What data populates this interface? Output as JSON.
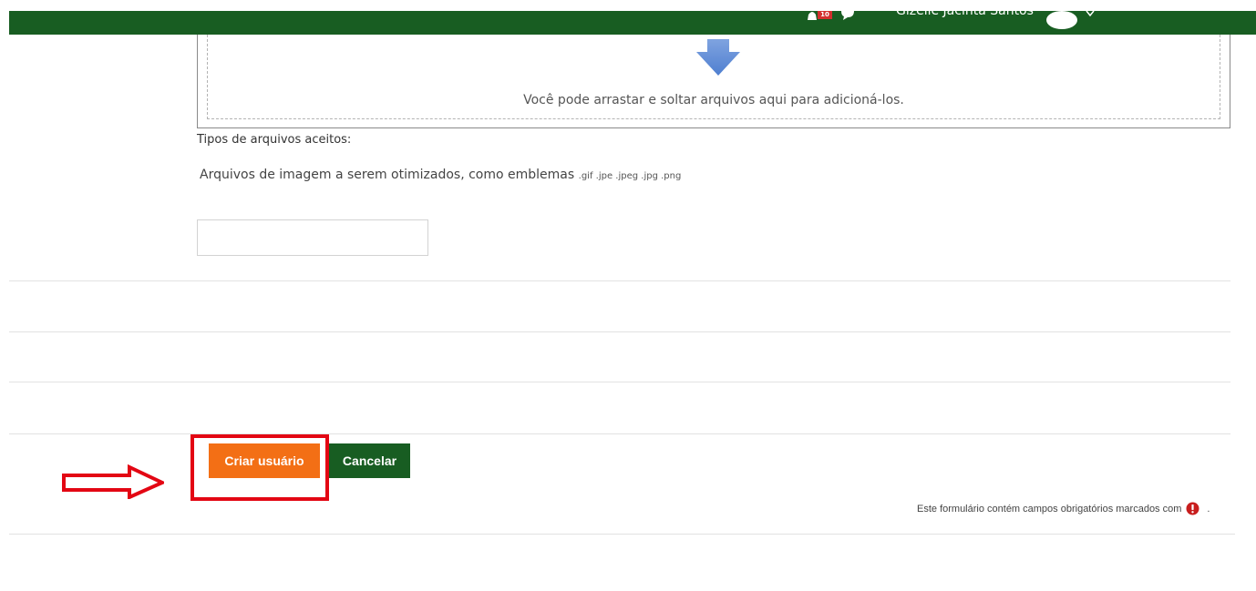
{
  "header": {
    "notification_count": "10",
    "user_name": "Gizelle Jacinta Santos"
  },
  "upload": {
    "drop_text": "Você pode arrastar e soltar arquivos aqui para adicioná-los."
  },
  "file_types": {
    "label": "Tipos de arquivos aceitos:",
    "description": "Arquivos de imagem a serem otimizados, como emblemas",
    "extensions": ".gif .jpe .jpeg .jpg .png"
  },
  "form": {
    "text_input_value": "",
    "submit_label": "Criar usuário",
    "cancel_label": "Cancelar",
    "required_note": "Este formulário contém campos obrigatórios marcados com",
    "required_note_end": "."
  },
  "colors": {
    "header_green": "#185d22",
    "primary_orange": "#f36f15",
    "annotation_red": "#e30613",
    "required_icon_red": "#c81e1e"
  },
  "icons": {
    "notifications": "bell-icon",
    "messages": "chat-bubble-icon",
    "avatar": "user-avatar-icon",
    "menu": "chevron-down-icon",
    "drop": "download-arrow-icon",
    "required": "exclamation-circle-icon",
    "annotation": "outline-right-arrow"
  }
}
